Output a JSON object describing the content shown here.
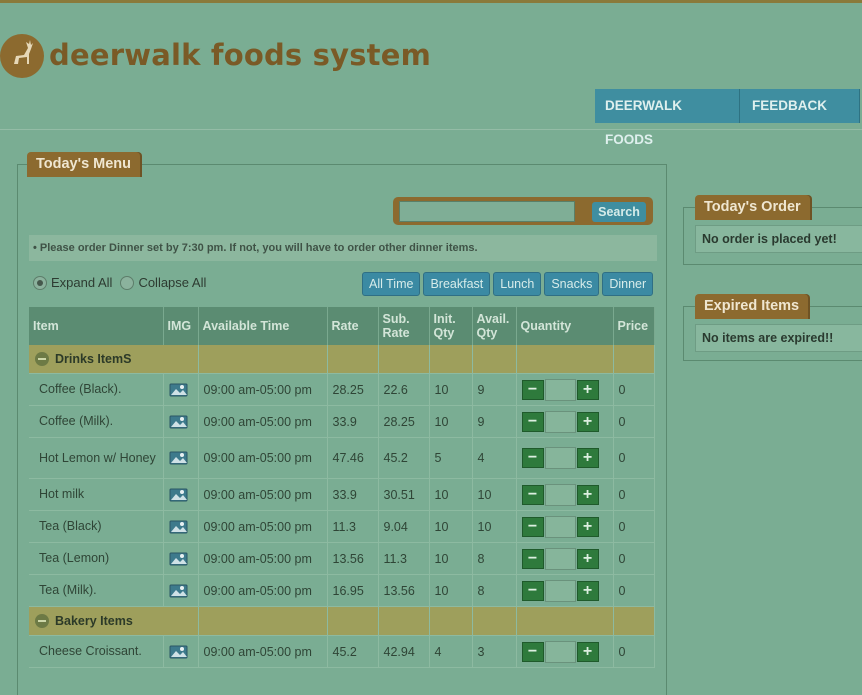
{
  "header": {
    "brand": "deerwalk foods system",
    "nav": [
      "DEERWALK FOODS",
      "FEEDBACK"
    ]
  },
  "menu": {
    "title": "Today's Menu",
    "search": {
      "value": "",
      "button": "Search"
    },
    "notice": "• Please order Dinner set by 7:30 pm. If not, you will have to order other dinner items.",
    "expand_label": "Expand All",
    "collapse_label": "Collapse All",
    "filters": [
      "All Time",
      "Breakfast",
      "Lunch",
      "Snacks",
      "Dinner"
    ],
    "columns": [
      "Item",
      "IMG",
      "Available Time",
      "Rate",
      "Sub. Rate",
      "Init. Qty",
      "Avail. Qty",
      "Quantity",
      "Price"
    ],
    "categories": [
      {
        "name": "Drinks ItemS",
        "items": [
          {
            "name": "Coffee (Black).",
            "time": "09:00 am-05:00 pm",
            "rate": "28.25",
            "sub_rate": "22.6",
            "init_qty": "10",
            "avail_qty": "9",
            "price": "0"
          },
          {
            "name": "Coffee (Milk).",
            "time": "09:00 am-05:00 pm",
            "rate": "33.9",
            "sub_rate": "28.25",
            "init_qty": "10",
            "avail_qty": "9",
            "price": "0"
          },
          {
            "name": "Hot Lemon w/ Honey",
            "time": "09:00 am-05:00 pm",
            "rate": "47.46",
            "sub_rate": "45.2",
            "init_qty": "5",
            "avail_qty": "4",
            "price": "0"
          },
          {
            "name": "Hot milk",
            "time": "09:00 am-05:00 pm",
            "rate": "33.9",
            "sub_rate": "30.51",
            "init_qty": "10",
            "avail_qty": "10",
            "price": "0"
          },
          {
            "name": "Tea (Black)",
            "time": "09:00 am-05:00 pm",
            "rate": "11.3",
            "sub_rate": "9.04",
            "init_qty": "10",
            "avail_qty": "10",
            "price": "0"
          },
          {
            "name": "Tea (Lemon)",
            "time": "09:00 am-05:00 pm",
            "rate": "13.56",
            "sub_rate": "11.3",
            "init_qty": "10",
            "avail_qty": "8",
            "price": "0"
          },
          {
            "name": "Tea (Milk).",
            "time": "09:00 am-05:00 pm",
            "rate": "16.95",
            "sub_rate": "13.56",
            "init_qty": "10",
            "avail_qty": "8",
            "price": "0"
          }
        ]
      },
      {
        "name": "Bakery Items",
        "items": [
          {
            "name": "Cheese Croissant.",
            "time": "09:00 am-05:00 pm",
            "rate": "45.2",
            "sub_rate": "42.94",
            "init_qty": "4",
            "avail_qty": "3",
            "price": "0"
          }
        ]
      }
    ]
  },
  "order": {
    "title": "Today's Order",
    "message": "No order is placed yet!"
  },
  "expired": {
    "title": "Expired Items",
    "message": "No items are expired!!"
  },
  "colors": {
    "brand": "#8c6a2f",
    "nav": "#3f8ea0",
    "plus_minus": "#2e7a3c"
  }
}
